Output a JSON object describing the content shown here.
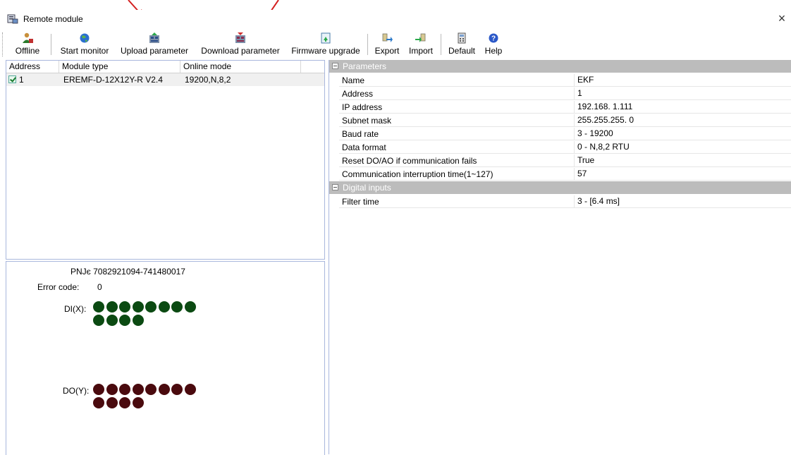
{
  "window": {
    "title": "Remote module",
    "close_label": "×",
    "app_icon": "module-window-icon"
  },
  "toolbar": {
    "buttons": [
      {
        "label": "Offline",
        "icon": "offline-user-icon"
      },
      {
        "label": "Start monitor",
        "icon": "monitor-globe-icon"
      },
      {
        "label": "Upload parameter",
        "icon": "upload-parameter-icon"
      },
      {
        "label": "Download parameter",
        "icon": "download-parameter-icon"
      },
      {
        "label": "Firmware upgrade",
        "icon": "firmware-upgrade-icon"
      },
      {
        "label": "Export",
        "icon": "export-icon"
      },
      {
        "label": "Import",
        "icon": "import-icon"
      },
      {
        "label": "Default",
        "icon": "default-calculator-icon"
      },
      {
        "label": "Help",
        "icon": "help-icon"
      }
    ]
  },
  "module_list": {
    "columns": [
      "Address",
      "Module type",
      "Online mode"
    ],
    "rows": [
      {
        "checked": true,
        "address": "1",
        "module_type": "EREMF-D-12X12Y-R V2.4",
        "online_mode": "19200,N,8,2"
      }
    ]
  },
  "status": {
    "pn": "PNJє 7082921094-741480017",
    "error_code_label": "Error code:",
    "error_code": "0",
    "di_label": "DI(X):",
    "di_count": 12,
    "do_label": "DO(Y):",
    "do_count": 12,
    "di_color": "#0b4a12",
    "do_color": "#4a0a0e"
  },
  "properties": {
    "categories": [
      {
        "name": "Parameters",
        "rows": [
          {
            "name": "Name",
            "value": "EKF"
          },
          {
            "name": "Address",
            "value": "1"
          },
          {
            "name": "IP address",
            "value": "192.168.  1.111"
          },
          {
            "name": "Subnet mask",
            "value": "255.255.255.  0"
          },
          {
            "name": "Baud rate",
            "value": "3 - 19200"
          },
          {
            "name": "Data format",
            "value": "0 - N,8,2 RTU"
          },
          {
            "name": "Reset DO/AO if communication fails",
            "value": "True"
          },
          {
            "name": "Communication interruption time(1~127)",
            "value": "57"
          }
        ]
      },
      {
        "name": "Digital inputs",
        "rows": [
          {
            "name": "Filter time",
            "value": "3 - [6.4 ms]"
          }
        ]
      }
    ]
  },
  "colors": {
    "annotation_arrow": "#d42020",
    "panel_border": "#a9b7dd",
    "category_bg": "#bcbcbc"
  }
}
